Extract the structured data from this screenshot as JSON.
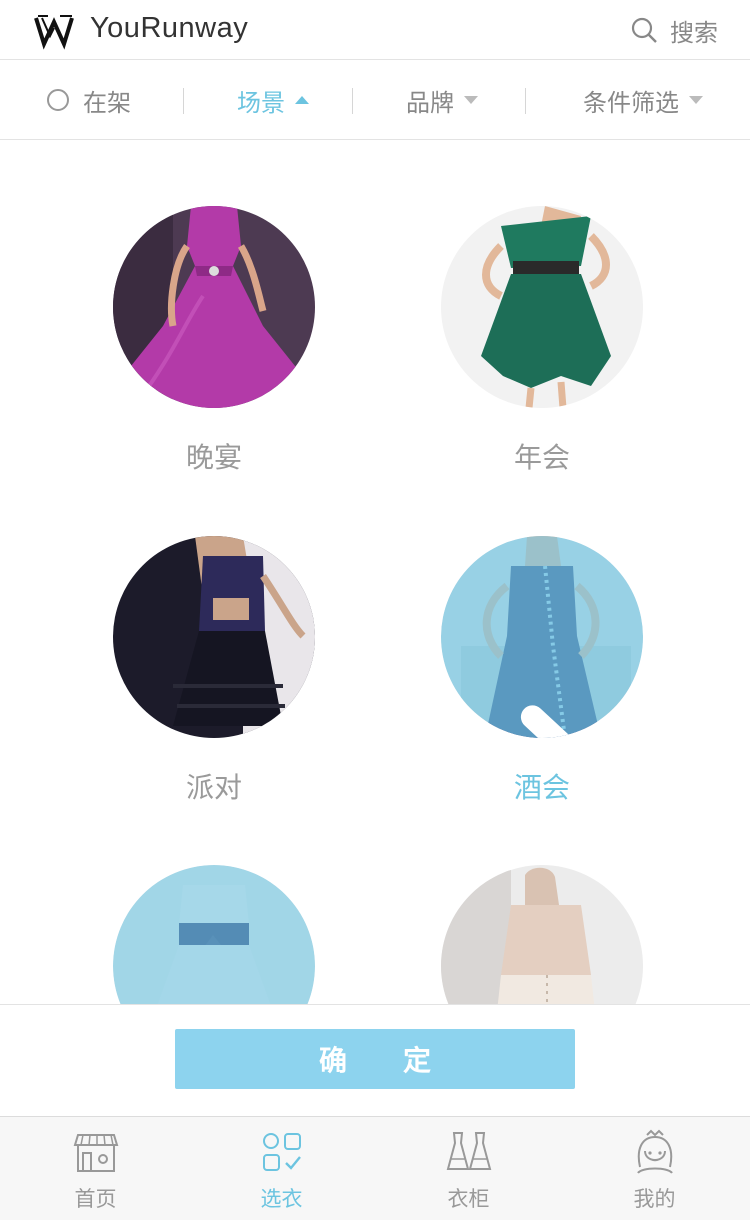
{
  "header": {
    "brand": "YouRunway",
    "search_label": "搜索"
  },
  "filters": {
    "in_stock": "在架",
    "scene": "场景",
    "brand": "品牌",
    "conditions": "条件筛选"
  },
  "scenes": [
    {
      "label": "晚宴",
      "selected": false
    },
    {
      "label": "年会",
      "selected": false
    },
    {
      "label": "派对",
      "selected": false
    },
    {
      "label": "酒会",
      "selected": true
    },
    {
      "label": "",
      "selected": true
    },
    {
      "label": "",
      "selected": false
    }
  ],
  "confirm": {
    "label": "确定"
  },
  "tabbar": {
    "items": [
      {
        "label": "首页",
        "icon": "store-icon",
        "active": false
      },
      {
        "label": "选衣",
        "icon": "grid-check-icon",
        "active": true
      },
      {
        "label": "衣柜",
        "icon": "dresses-icon",
        "active": false
      },
      {
        "label": "我的",
        "icon": "girl-face-icon",
        "active": false
      }
    ]
  },
  "colors": {
    "accent": "#6cc4e0",
    "button": "#8dd3ee",
    "selected_overlay": "#76c6e0"
  }
}
